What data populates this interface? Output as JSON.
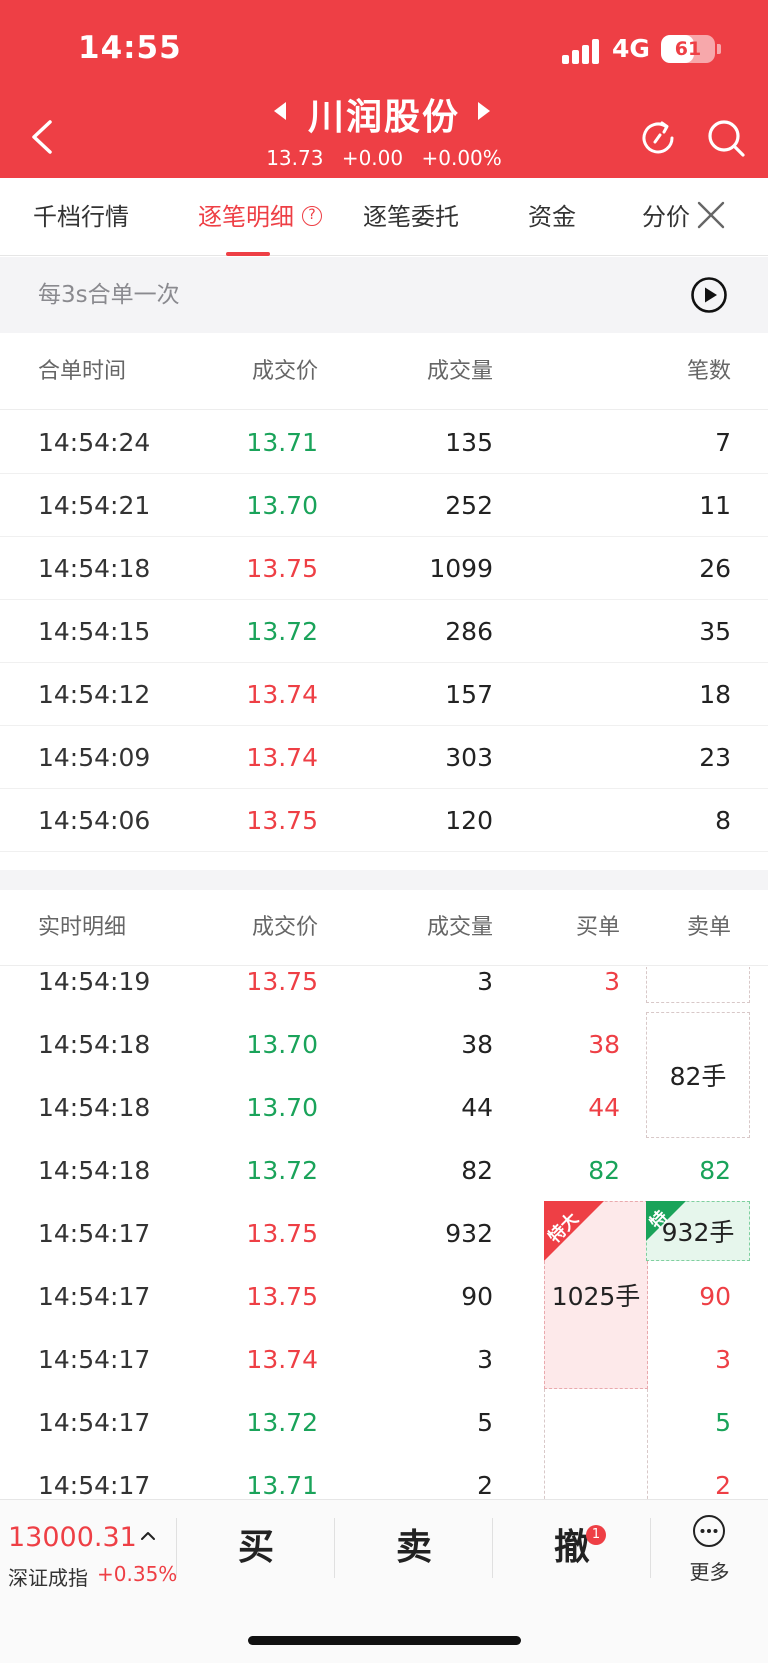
{
  "status_bar": {
    "time": "14:55",
    "network": "4G",
    "battery": "61",
    "battery_level": 0.61
  },
  "header": {
    "stock_name": "川润股份",
    "price": "13.73",
    "change": "+0.00",
    "change_pct": "+0.00%"
  },
  "tabs": [
    {
      "label": "千档行情"
    },
    {
      "label": "逐笔明细"
    },
    {
      "label": "逐笔委托"
    },
    {
      "label": "资金"
    },
    {
      "label": "分价"
    }
  ],
  "info_bar": {
    "text": "每3s合单一次"
  },
  "merged_table": {
    "headers": {
      "time": "合单时间",
      "price": "成交价",
      "volume": "成交量",
      "count": "笔数"
    },
    "rows": [
      {
        "time": "14:54:24",
        "price": "13.71",
        "dir": "down",
        "volume": "135",
        "count": "7"
      },
      {
        "time": "14:54:21",
        "price": "13.70",
        "dir": "down",
        "volume": "252",
        "count": "11"
      },
      {
        "time": "14:54:18",
        "price": "13.75",
        "dir": "up",
        "volume": "1099",
        "count": "26"
      },
      {
        "time": "14:54:15",
        "price": "13.72",
        "dir": "down",
        "volume": "286",
        "count": "35"
      },
      {
        "time": "14:54:12",
        "price": "13.74",
        "dir": "up",
        "volume": "157",
        "count": "18"
      },
      {
        "time": "14:54:09",
        "price": "13.74",
        "dir": "up",
        "volume": "303",
        "count": "23"
      },
      {
        "time": "14:54:06",
        "price": "13.75",
        "dir": "up",
        "volume": "120",
        "count": "8"
      }
    ]
  },
  "realtime_table": {
    "headers": {
      "time": "实时明细",
      "price": "成交价",
      "volume": "成交量",
      "buy": "买单",
      "sell": "卖单"
    },
    "rows": [
      {
        "time": "14:54:19",
        "price": "13.75",
        "dir": "up",
        "volume": "3",
        "buy": "3",
        "buy_dir": "up",
        "sell": "",
        "sell_dir": ""
      },
      {
        "time": "14:54:18",
        "price": "13.70",
        "dir": "down",
        "volume": "38",
        "buy": "38",
        "buy_dir": "up",
        "sell": "",
        "sell_dir": ""
      },
      {
        "time": "14:54:18",
        "price": "13.70",
        "dir": "down",
        "volume": "44",
        "buy": "44",
        "buy_dir": "up",
        "sell": "",
        "sell_dir": ""
      },
      {
        "time": "14:54:18",
        "price": "13.72",
        "dir": "down",
        "volume": "82",
        "buy": "82",
        "buy_dir": "down",
        "sell": "82",
        "sell_dir": "down"
      },
      {
        "time": "14:54:17",
        "price": "13.75",
        "dir": "up",
        "volume": "932",
        "buy": "",
        "buy_dir": "",
        "sell": "",
        "sell_dir": ""
      },
      {
        "time": "14:54:17",
        "price": "13.75",
        "dir": "up",
        "volume": "90",
        "buy": "",
        "buy_dir": "",
        "sell": "90",
        "sell_dir": "up"
      },
      {
        "time": "14:54:17",
        "price": "13.74",
        "dir": "up",
        "volume": "3",
        "buy": "",
        "buy_dir": "",
        "sell": "3",
        "sell_dir": "up"
      },
      {
        "time": "14:54:17",
        "price": "13.72",
        "dir": "down",
        "volume": "5",
        "buy": "",
        "buy_dir": "",
        "sell": "5",
        "sell_dir": "down"
      },
      {
        "time": "14:54:17",
        "price": "13.71",
        "dir": "down",
        "volume": "2",
        "buy": "",
        "buy_dir": "",
        "sell": "2",
        "sell_dir": "up"
      }
    ],
    "merged_orders": {
      "sell_82": "82手",
      "buy_1025": "1025手",
      "buy_1025_tag": "特大",
      "sell_932": "932手",
      "sell_932_tag": "特"
    }
  },
  "bottom_bar": {
    "index_value": "13000.31",
    "index_name": "深证成指",
    "index_change": "+0.35%",
    "buy_label": "买",
    "sell_label": "卖",
    "cancel_label": "撤",
    "cancel_badge": "1",
    "more_label": "更多"
  },
  "colors": {
    "accent": "#ee3f45",
    "up": "#ee3f45",
    "down": "#1aa35a"
  }
}
